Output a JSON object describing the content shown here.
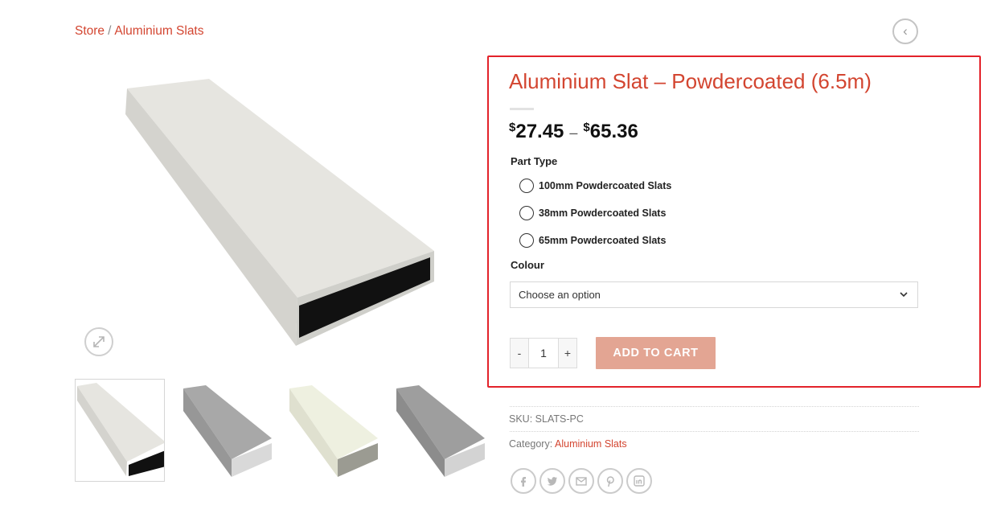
{
  "breadcrumb": {
    "store": "Store",
    "separator": "/",
    "category": "Aluminium Slats"
  },
  "product": {
    "title": "Aluminium Slat – Powdercoated (6.5m)",
    "price_min": "27.45",
    "price_max": "65.36",
    "currency_symbol": "$",
    "price_separator": "–"
  },
  "variations": {
    "part_type_label": "Part Type",
    "part_types": [
      "100mm Powdercoated Slats",
      "38mm Powdercoated Slats",
      "65mm Powdercoated Slats"
    ],
    "colour_label": "Colour",
    "colour_placeholder": "Choose an option"
  },
  "cart": {
    "minus": "-",
    "quantity": "1",
    "plus": "+",
    "add_label": "ADD TO CART"
  },
  "meta": {
    "sku_label": "SKU:",
    "sku": "SLATS-PC",
    "category_label": "Category:",
    "category": "Aluminium Slats"
  },
  "share_icons": [
    "facebook-icon",
    "twitter-icon",
    "email-icon",
    "pinterest-icon",
    "linkedin-icon"
  ],
  "colors": {
    "accent": "#d34530",
    "add_to_cart": "#e3a593",
    "highlight": "#e3222a"
  }
}
